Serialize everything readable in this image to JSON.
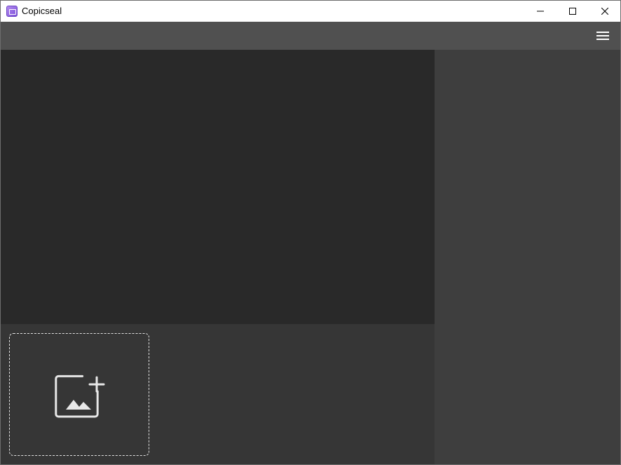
{
  "window": {
    "title": "Copicseal",
    "app_icon": "app-logo-icon",
    "controls": [
      "minimize-icon",
      "maximize-icon",
      "close-icon"
    ]
  },
  "toolbar": {
    "menu_icon": "hamburger-menu-icon"
  },
  "thumbnail_strip": {
    "add_tile_icon": "add-image-icon"
  },
  "colors": {
    "toolbar": "#505050",
    "preview": "#292929",
    "thumbnail_strip": "#363636",
    "right_panel": "#3e3e3e"
  }
}
